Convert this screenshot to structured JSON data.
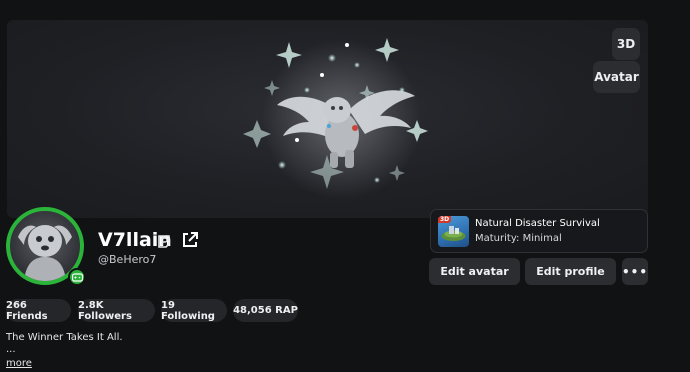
{
  "banner": {
    "view_3d_label": "3D",
    "view_avatar_label": "Avatar"
  },
  "profile": {
    "display_name": "V7llain",
    "username": "@BeHero7",
    "online_status_color": "#2bb43a"
  },
  "current_game": {
    "title": "Natural Disaster Survival",
    "maturity": "Maturity: Minimal",
    "thumb_tag": "3D"
  },
  "actions": {
    "edit_avatar": "Edit avatar",
    "edit_profile": "Edit profile",
    "more": "•••"
  },
  "stats": {
    "friends": "266 Friends",
    "followers": "2.8K Followers",
    "following": "19 Following",
    "rap": "48,056 RAP"
  },
  "bio": {
    "line1": "The Winner Takes It All.",
    "line2": "...",
    "more_label": "more"
  },
  "colors": {
    "background": "#111214",
    "button": "#2b2d31",
    "accent_green": "#2bb43a"
  }
}
